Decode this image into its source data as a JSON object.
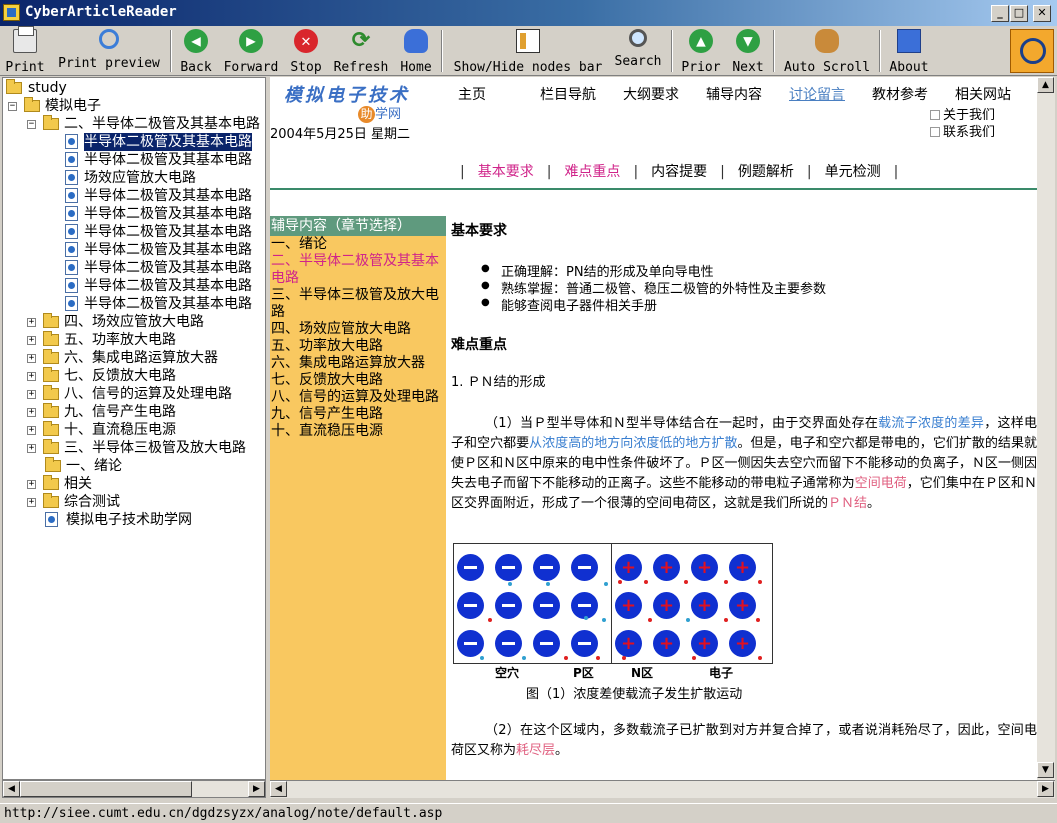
{
  "window": {
    "title": "CyberArticleReader"
  },
  "toolbar": {
    "print": "Print",
    "print_preview": "Print preview",
    "back": "Back",
    "forward": "Forward",
    "stop": "Stop",
    "refresh": "Refresh",
    "home": "Home",
    "show_hide": "Show/Hide nodes bar",
    "search": "Search",
    "prior": "Prior",
    "next": "Next",
    "auto_scroll": "Auto Scroll",
    "about": "About"
  },
  "tree": {
    "root": "study",
    "book": "模拟电子",
    "chapter2": "二、半导体二极管及其基本电路",
    "chapter2_items": [
      "半导体二极管及其基本电路",
      "半导体二极管及其基本电路",
      "场效应管放大电路",
      "半导体二极管及其基本电路",
      "半导体二极管及其基本电路",
      "半导体二极管及其基本电路",
      "半导体二极管及其基本电路",
      "半导体二极管及其基本电路",
      "半导体二极管及其基本电路",
      "半导体二极管及其基本电路"
    ],
    "chapters": [
      "四、场效应管放大电路",
      "五、功率放大电路",
      "六、集成电路运算放大器",
      "七、反馈放大电路",
      "八、信号的运算及处理电路",
      "九、信号产生电路",
      "十、直流稳压电源",
      "三、半导体三极管及放大电路"
    ],
    "intro": "一、绪论",
    "related": "相关",
    "test": "综合测试",
    "site": "模拟电子技术助学网"
  },
  "site": {
    "logo_main": "模拟电子技术",
    "logo_sub_ball": "助",
    "logo_sub": "学网",
    "date": "2004年5月25日 星期二",
    "nav": [
      "主页",
      "栏目导航",
      "大纲要求",
      "辅导内容",
      "讨论留言",
      "教材参考",
      "相关网站"
    ],
    "check_about": "关于我们",
    "check_contact": "联系我们",
    "subnav": [
      "基本要求",
      "难点重点",
      "内容提要",
      "例题解析",
      "单元检测"
    ],
    "side_head": "辅导内容（章节选择）",
    "side_links": [
      "一、绪论",
      "二、半导体二极管及其基本电路",
      "三、半导体三极管及放大电路",
      "四、场效应管放大电路",
      "五、功率放大电路",
      "六、集成电路运算放大器",
      "七、反馈放大电路",
      "八、信号的运算及处理电路",
      "九、信号产生电路",
      "十、直流稳压电源"
    ]
  },
  "article": {
    "h_basic": "基本要求",
    "bullets": [
      "正确理解：PN结的形成及单向导电性",
      "熟练掌握：普通二极管、稳压二极管的外特性及主要参数",
      "能够查阅电子器件相关手册"
    ],
    "h_key": "难点重点",
    "sec1": "1.  ＰＮ结的形成",
    "p1_a": "（1）当Ｐ型半导体和Ｎ型半导体结合在一起时，由于交界面处存在",
    "p1_b": "载流子浓度的差异",
    "p1_c": "，这样电子和空穴都要",
    "p1_d": "从浓度高的地方向浓度低的地方扩散",
    "p1_e": "。但是，电子和空穴都是带电的，它们扩散的结果就使Ｐ区和Ｎ区中原来的电中性条件破坏了。Ｐ区一侧因失去空穴而留下不能移动的负离子，Ｎ区一侧因失去电子而留下不能移动的正离子。这些不能移动的带电粒子通常称为",
    "p1_f": "空间电荷",
    "p1_g": "，它们集中在Ｐ区和Ｎ区交界面附近，形成了一个很薄的空间电荷区，这就是我们所说的",
    "p1_h": "ＰＮ结",
    "p1_i": "。",
    "fig_labels": [
      "空穴",
      "P区",
      "N区",
      "电子"
    ],
    "fig_caption": "图（1）浓度差使载流子发生扩散运动",
    "p2_a": "（2）在这个区域内，多数载流子已扩散到对方并复合掉了，或者说消耗殆尽了，因此，空间电荷区又称为",
    "p2_b": "耗尽层",
    "p2_c": "。"
  },
  "status": {
    "url": "http://siee.cumt.edu.cn/dgdzsyzx/analog/note/default.asp"
  }
}
